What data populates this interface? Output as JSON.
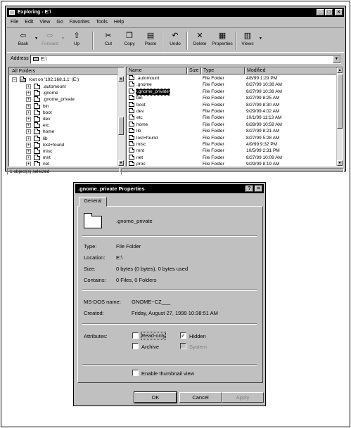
{
  "explorer": {
    "title": "Exploring - E:\\",
    "menu": [
      "File",
      "Edit",
      "View",
      "Go",
      "Favorites",
      "Tools",
      "Help"
    ],
    "toolbar": {
      "back": "Back",
      "forward": "Forward",
      "up": "Up",
      "cut": "Cut",
      "copy": "Copy",
      "paste": "Paste",
      "undo": "Undo",
      "delete": "Delete",
      "properties": "Properties",
      "views": "Views"
    },
    "address_label": "Address",
    "address_value": "E:\\",
    "all_folders_label": "All Folders",
    "tree_root": "root on '192.168.1.1' (E:)",
    "tree_items": [
      ".automount",
      ".gnome",
      ".gnome_private",
      "bin",
      "boot",
      "dev",
      "etc",
      "home",
      "lib",
      "lost+found",
      "misc",
      "mnt",
      "net"
    ],
    "columns": {
      "name": "Name",
      "size": "Size",
      "type": "Type",
      "modified": "Modified"
    },
    "files": [
      {
        "name": ".automount",
        "type": "File Folder",
        "modified": "4/8/99 1:29 PM"
      },
      {
        "name": ".gnome",
        "type": "File Folder",
        "modified": "8/27/99 10:38 AM"
      },
      {
        "name": ".gnome_private",
        "type": "File Folder",
        "modified": "8/27/99 10:38 AM"
      },
      {
        "name": "bin",
        "type": "File Folder",
        "modified": "8/27/99 8:25 AM"
      },
      {
        "name": "boot",
        "type": "File Folder",
        "modified": "8/27/99 8:30 AM"
      },
      {
        "name": "dev",
        "type": "File Folder",
        "modified": "9/29/99 4:02 AM"
      },
      {
        "name": "etc",
        "type": "File Folder",
        "modified": "10/1/99 11:13 AM"
      },
      {
        "name": "home",
        "type": "File Folder",
        "modified": "8/28/99 10:59 AM"
      },
      {
        "name": "lib",
        "type": "File Folder",
        "modified": "8/27/99 8:21 AM"
      },
      {
        "name": "lost+found",
        "type": "File Folder",
        "modified": "8/27/99 5:28 AM"
      },
      {
        "name": "misc",
        "type": "File Folder",
        "modified": "4/9/99 9:32 PM"
      },
      {
        "name": "mnt",
        "type": "File Folder",
        "modified": "10/5/99 2:31 PM"
      },
      {
        "name": "net",
        "type": "File Folder",
        "modified": "8/27/99 10:09 AM"
      },
      {
        "name": "proc",
        "type": "File Folder",
        "modified": "9/29/99 8:19 AM"
      }
    ],
    "status": "1 object(s) selected"
  },
  "dialog": {
    "title": ".gnome_private Properties",
    "tab_general": "General",
    "folder_name": ".gnome_private",
    "type_label": "Type:",
    "type_value": "File Folder",
    "location_label": "Location:",
    "location_value": "E:\\",
    "size_label": "Size:",
    "size_value": "0 bytes (0 bytes), 0 bytes used",
    "contains_label": "Contains:",
    "contains_value": "0 Files, 0 Folders",
    "msdos_label": "MS-DOS name:",
    "msdos_value": "GNOME~CZ___",
    "created_label": "Created:",
    "created_value": "Friday, August 27, 1999 10:38:51 AM",
    "attributes_label": "Attributes:",
    "readonly_label": "Read-only",
    "archive_label": "Archive",
    "hidden_label": "Hidden",
    "system_label": "System",
    "thumbnail_label": "Enable thumbnail view",
    "ok_label": "OK",
    "cancel_label": "Cancel",
    "apply_label": "Apply"
  }
}
